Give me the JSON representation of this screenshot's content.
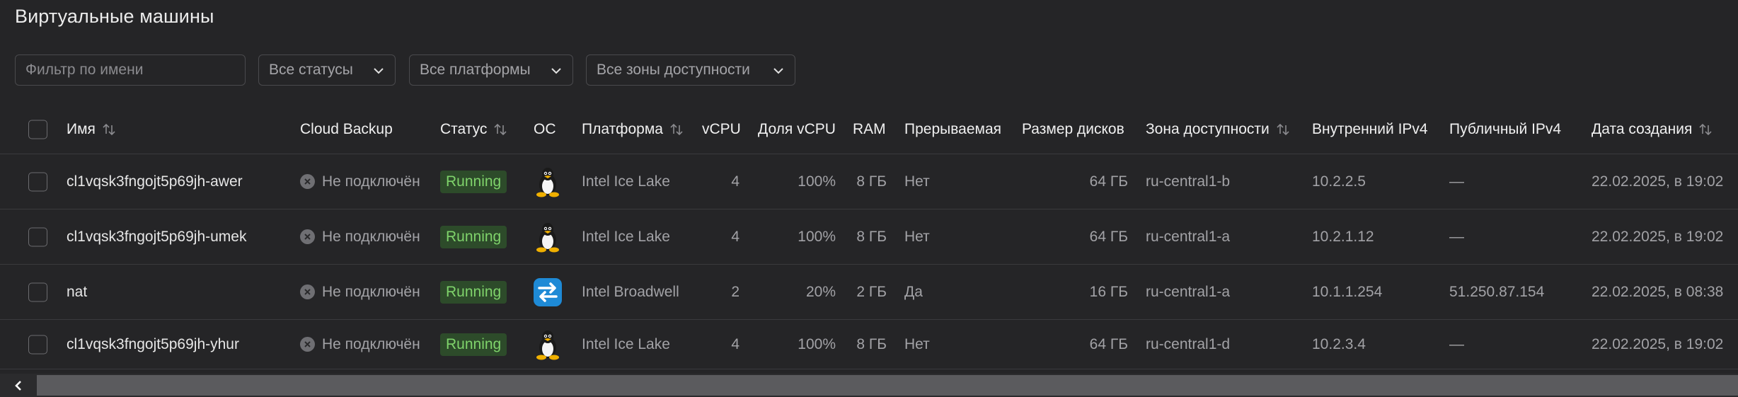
{
  "page": {
    "title": "Виртуальные машины"
  },
  "filters": {
    "name_placeholder": "Фильтр по имени",
    "status_select": "Все статусы",
    "platform_select": "Все платформы",
    "zone_select": "Все зоны доступности"
  },
  "table": {
    "columns": {
      "name": "Имя",
      "backup": "Cloud Backup",
      "status": "Статус",
      "os": "ОС",
      "platform": "Платформа",
      "vcpu": "vCPU",
      "vcpu_share": "Доля vCPU",
      "ram": "RAM",
      "preemptible": "Прерываемая",
      "disk_size": "Размер дисков",
      "zone": "Зона доступности",
      "internal_ip": "Внутренний IPv4",
      "public_ip": "Публичный IPv4",
      "created": "Дата создания"
    },
    "rows": [
      {
        "name": "cl1vqsk3fngojt5p69jh-awer",
        "backup": "Не подключён",
        "status": "Running",
        "os": "linux-icon",
        "platform": "Intel Ice Lake",
        "vcpu": "4",
        "vcpu_share": "100%",
        "ram": "8 ГБ",
        "preemptible": "Нет",
        "disk_size": "64 ГБ",
        "zone": "ru-central1-b",
        "internal_ip": "10.2.2.5",
        "public_ip": "—",
        "created": "22.02.2025, в 19:02"
      },
      {
        "name": "cl1vqsk3fngojt5p69jh-umek",
        "backup": "Не подключён",
        "status": "Running",
        "os": "linux-icon",
        "platform": "Intel Ice Lake",
        "vcpu": "4",
        "vcpu_share": "100%",
        "ram": "8 ГБ",
        "preemptible": "Нет",
        "disk_size": "64 ГБ",
        "zone": "ru-central1-a",
        "internal_ip": "10.2.1.12",
        "public_ip": "—",
        "created": "22.02.2025, в 19:02"
      },
      {
        "name": "nat",
        "backup": "Не подключён",
        "status": "Running",
        "os": "nat-instance-icon",
        "platform": "Intel Broadwell",
        "vcpu": "2",
        "vcpu_share": "20%",
        "ram": "2 ГБ",
        "preemptible": "Да",
        "disk_size": "16 ГБ",
        "zone": "ru-central1-a",
        "internal_ip": "10.1.1.254",
        "public_ip": "51.250.87.154",
        "created": "22.02.2025, в 08:38"
      },
      {
        "name": "cl1vqsk3fngojt5p69jh-yhur",
        "backup": "Не подключён",
        "status": "Running",
        "os": "linux-icon",
        "platform": "Intel Ice Lake",
        "vcpu": "4",
        "vcpu_share": "100%",
        "ram": "8 ГБ",
        "preemptible": "Нет",
        "disk_size": "64 ГБ",
        "zone": "ru-central1-d",
        "internal_ip": "10.2.3.4",
        "public_ip": "—",
        "created": "22.02.2025, в 19:02"
      }
    ]
  },
  "colors": {
    "background": "#252527",
    "status_running_bg": "#2d4b2a",
    "status_running_text": "#7fd36b",
    "border": "#3a3a3d"
  }
}
